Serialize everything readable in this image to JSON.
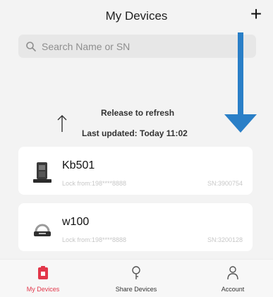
{
  "header": {
    "title": "My Devices",
    "add_label": "+"
  },
  "search": {
    "placeholder": "Search Name or SN"
  },
  "refresh": {
    "release_text": "Release to refresh",
    "last_updated": "Last updated: Today 11:02"
  },
  "devices": [
    {
      "name": "Kb501",
      "lock_from": "Lock from:198****8888",
      "sn": "SN:3900754",
      "icon": "keypad-lock-icon"
    },
    {
      "name": "w100",
      "lock_from": "Lock from:198****8888",
      "sn": "SN:3200128",
      "icon": "padlock-device-icon"
    }
  ],
  "tabs": [
    {
      "label": "My Devices",
      "icon": "my-devices-icon",
      "active": true
    },
    {
      "label": "Share Devices",
      "icon": "share-devices-icon",
      "active": false
    },
    {
      "label": "Account",
      "icon": "account-icon",
      "active": false
    }
  ],
  "colors": {
    "accent": "#e2374a",
    "guide_arrow": "#2a7fc7",
    "background": "#f3f3f3"
  }
}
